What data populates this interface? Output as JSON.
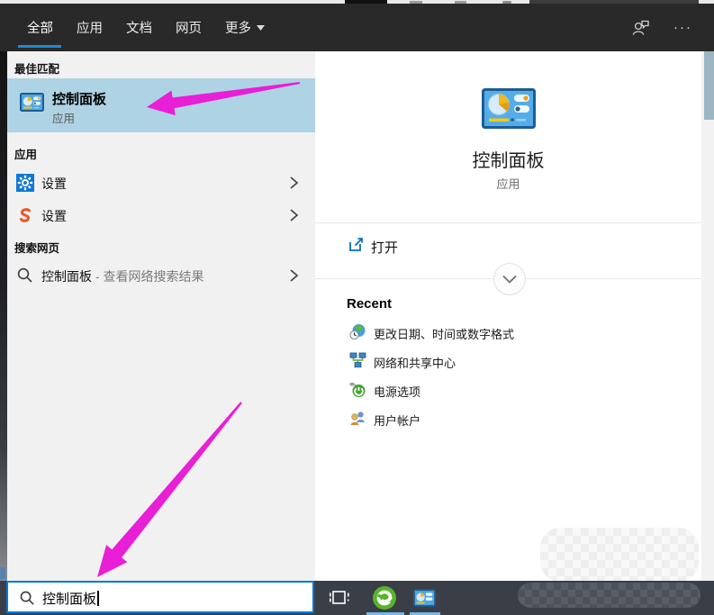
{
  "header": {
    "tabs": [
      {
        "label": "全部",
        "selected": true
      },
      {
        "label": "应用",
        "selected": false
      },
      {
        "label": "文档",
        "selected": false
      },
      {
        "label": "网页",
        "selected": false
      },
      {
        "label": "更多",
        "selected": false,
        "dropdown": true
      }
    ],
    "ellipsis": "···",
    "icons": [
      "user-feedback-icon",
      "ellipsis-icon"
    ]
  },
  "left": {
    "best": {
      "header": "最佳匹配",
      "title": "控制面板",
      "subtitle": "应用",
      "icon": "control-panel-icon",
      "selected": true
    },
    "apps": {
      "header": "应用",
      "items": [
        {
          "label": "设置",
          "icon": "settings-gear-icon"
        },
        {
          "label": "设置",
          "icon": "sogou-settings-icon"
        }
      ]
    },
    "web": {
      "header": "搜索网页",
      "query": "控制面板",
      "suffix": "- 查看网络搜索结果",
      "icon": "search-icon"
    }
  },
  "right": {
    "title": "控制面板",
    "subtitle": "应用",
    "app_icon": "control-panel-icon-large",
    "open_label": "打开",
    "open_icon": "open-external-icon",
    "expander_icon": "chevron-down-icon",
    "recent_header": "Recent",
    "recent_items": [
      {
        "label": "更改日期、时间或数字格式",
        "icon": "region-clock-icon"
      },
      {
        "label": "网络和共享中心",
        "icon": "network-icon"
      },
      {
        "label": "电源选项",
        "icon": "power-icon"
      },
      {
        "label": "用户帐户",
        "icon": "user-accounts-icon"
      }
    ]
  },
  "taskbar": {
    "search_value": "控制面板",
    "search_icon": "search-icon",
    "buttons": [
      {
        "icon": "task-view-icon",
        "active": false
      },
      {
        "icon": "green-browser-icon",
        "active": true
      },
      {
        "icon": "control-panel-icon",
        "active": true
      }
    ]
  },
  "annotations": {
    "arrow_count": 2,
    "arrow_color": "#e81fd6"
  },
  "colors": {
    "accent_blue": "#0277d7",
    "highlight_row": "#aed3e4",
    "header_bg": "#292929",
    "taskbar_bg": "#3a3e46",
    "panel_bg": "#f1f1f1",
    "magenta_arrow": "#e81fd6"
  }
}
